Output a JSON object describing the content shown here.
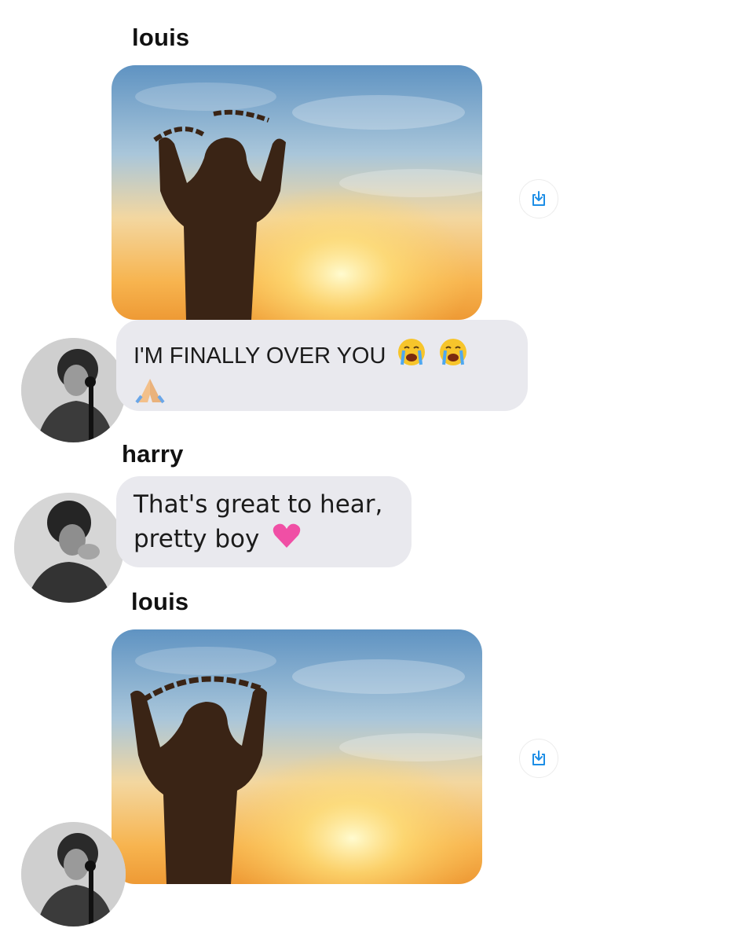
{
  "messages": [
    {
      "sender": "louis",
      "type": "image",
      "image": "chain-breaking-silhouette-sunset",
      "action_icon": "save-download-icon"
    },
    {
      "sender": "louis",
      "type": "text",
      "lines": [
        "I'M FINALLY OVER YOU",
        ""
      ],
      "emojis": [
        "loudly-crying-face",
        "loudly-crying-face",
        "folded-hands"
      ],
      "avatar": "louis-avatar"
    },
    {
      "sender": "harry",
      "type": "text",
      "lines": [
        "That's great to hear,",
        "pretty boy"
      ],
      "emojis": [
        "pink-heart"
      ],
      "avatar": "harry-avatar"
    },
    {
      "sender": "louis",
      "type": "image",
      "image": "chains-held-silhouette-sunset",
      "action_icon": "save-download-icon",
      "avatar": "louis-avatar"
    }
  ],
  "colors": {
    "bubble": "#e9e9ee",
    "text": "#1b1b1b",
    "accent_icon": "#1d8ee6",
    "sky_top": "#5f93c2",
    "sun": "#fff3a6",
    "silhouette": "#3a2415"
  }
}
